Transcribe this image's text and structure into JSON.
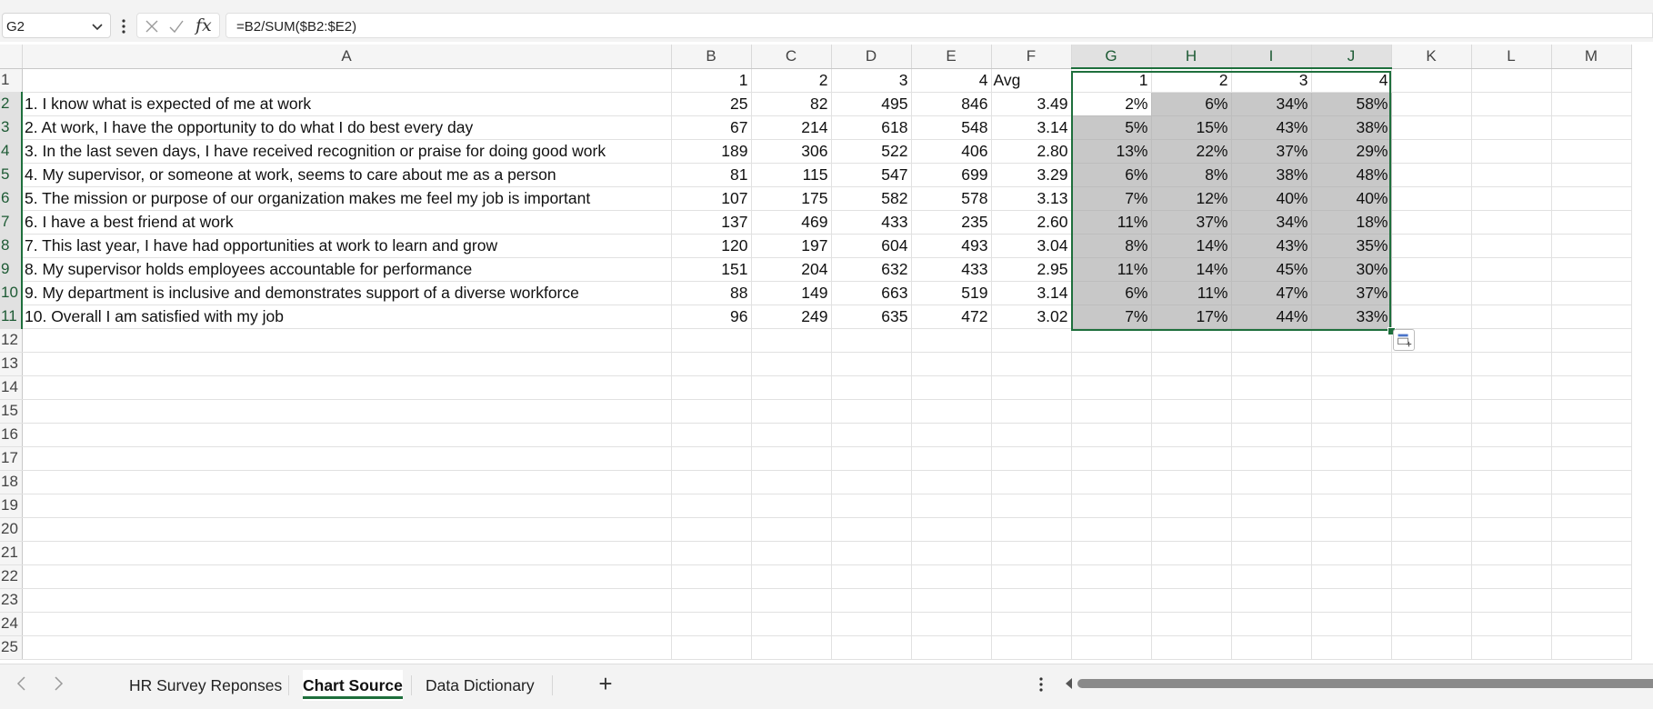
{
  "formula_bar": {
    "cell_ref": "G2",
    "formula": "=B2/SUM($B2:$E2)",
    "fx_label": "fx"
  },
  "grid": {
    "columns": [
      "A",
      "B",
      "C",
      "D",
      "E",
      "F",
      "G",
      "H",
      "I",
      "J",
      "K",
      "L",
      "M"
    ],
    "header_row": {
      "b": "1",
      "c": "2",
      "d": "3",
      "e": "4",
      "f": "Avg",
      "g": "1",
      "h": "2",
      "i": "3",
      "j": "4"
    },
    "rows": [
      {
        "n": "2",
        "q": "1. I know what is expected of me at work",
        "b": "25",
        "c": "82",
        "d": "495",
        "e": "846",
        "f": "3.49",
        "g": "2%",
        "h": "6%",
        "i": "34%",
        "j": "58%"
      },
      {
        "n": "3",
        "q": "2. At work, I have the opportunity to do what I do best every day",
        "b": "67",
        "c": "214",
        "d": "618",
        "e": "548",
        "f": "3.14",
        "g": "5%",
        "h": "15%",
        "i": "43%",
        "j": "38%"
      },
      {
        "n": "4",
        "q": "3. In the last seven days, I have received recognition or praise for doing good work",
        "b": "189",
        "c": "306",
        "d": "522",
        "e": "406",
        "f": "2.80",
        "g": "13%",
        "h": "22%",
        "i": "37%",
        "j": "29%"
      },
      {
        "n": "5",
        "q": "4. My supervisor, or someone at work, seems to care about me as a person",
        "b": "81",
        "c": "115",
        "d": "547",
        "e": "699",
        "f": "3.29",
        "g": "6%",
        "h": "8%",
        "i": "38%",
        "j": "48%"
      },
      {
        "n": "6",
        "q": "5. The mission or purpose of our organization makes me feel my job is important",
        "b": "107",
        "c": "175",
        "d": "582",
        "e": "578",
        "f": "3.13",
        "g": "7%",
        "h": "12%",
        "i": "40%",
        "j": "40%"
      },
      {
        "n": "7",
        "q": "6. I have a best friend at work",
        "b": "137",
        "c": "469",
        "d": "433",
        "e": "235",
        "f": "2.60",
        "g": "11%",
        "h": "37%",
        "i": "34%",
        "j": "18%"
      },
      {
        "n": "8",
        "q": "7. This last year, I have had opportunities at work to learn and grow",
        "b": "120",
        "c": "197",
        "d": "604",
        "e": "493",
        "f": "3.04",
        "g": "8%",
        "h": "14%",
        "i": "43%",
        "j": "35%"
      },
      {
        "n": "9",
        "q": "8. My supervisor holds employees accountable for performance",
        "b": "151",
        "c": "204",
        "d": "632",
        "e": "433",
        "f": "2.95",
        "g": "11%",
        "h": "14%",
        "i": "45%",
        "j": "30%"
      },
      {
        "n": "10",
        "q": "9. My department is inclusive and demonstrates support of a diverse workforce",
        "b": "88",
        "c": "149",
        "d": "663",
        "e": "519",
        "f": "3.14",
        "g": "6%",
        "h": "11%",
        "i": "47%",
        "j": "37%"
      },
      {
        "n": "11",
        "q": "10. Overall I am satisfied with my job",
        "b": "96",
        "c": "249",
        "d": "635",
        "e": "472",
        "f": "3.02",
        "g": "7%",
        "h": "17%",
        "i": "44%",
        "j": "33%"
      }
    ],
    "empty_rows": [
      "12",
      "13",
      "14",
      "15",
      "16",
      "17",
      "18",
      "19",
      "20",
      "21",
      "22",
      "23",
      "24",
      "25"
    ],
    "row1_label": "1"
  },
  "sheet_tabs": [
    {
      "label": "HR Survey Reponses",
      "active": false
    },
    {
      "label": "Chart Source",
      "active": true
    },
    {
      "label": "Data Dictionary",
      "active": false
    }
  ],
  "add_sheet_label": "+",
  "colors": {
    "accent": "#1e6f3c",
    "selection_fill": "#c8c8c8",
    "chrome": "#f3f3f3"
  }
}
